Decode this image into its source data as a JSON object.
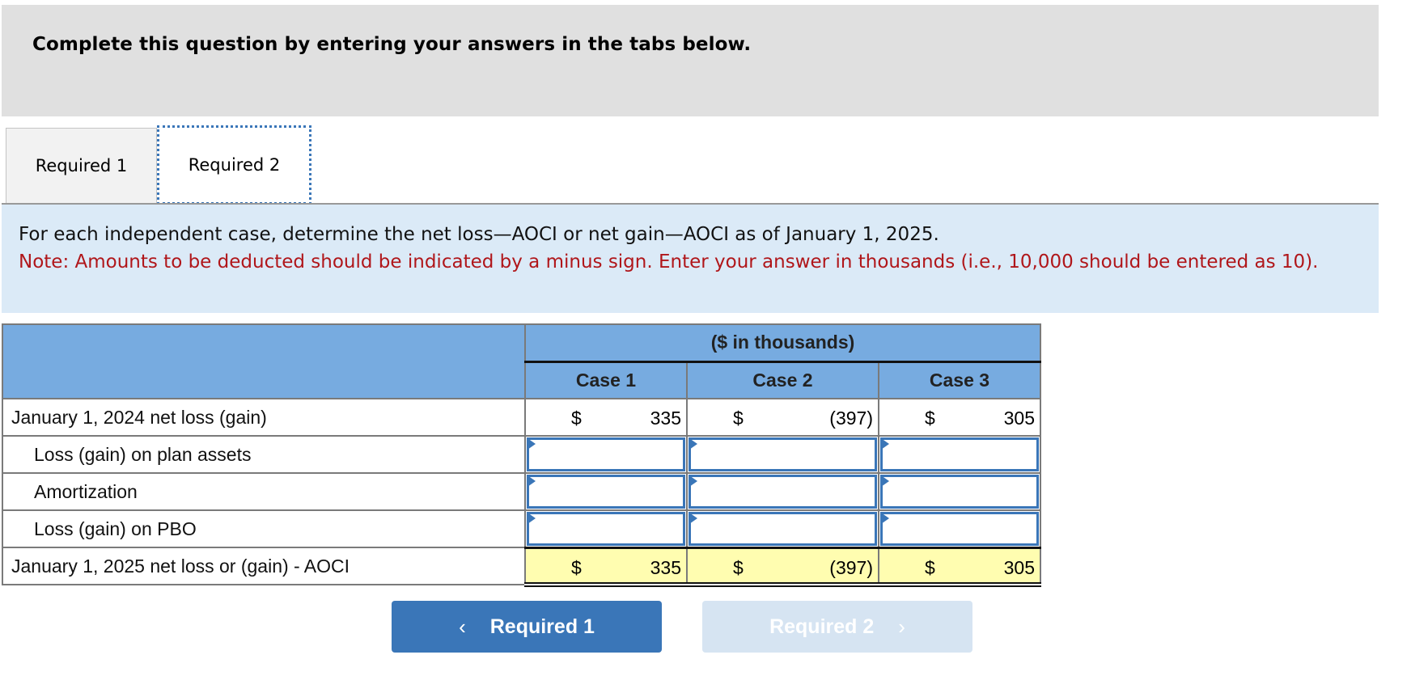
{
  "instructions": "Complete this question by entering your answers in the tabs below.",
  "tabs": [
    {
      "label": "Required 1",
      "active": false
    },
    {
      "label": "Required 2",
      "active": true
    }
  ],
  "prompt": {
    "main": "For each independent case, determine the net loss—AOCI or net gain—AOCI as of January 1, 2025.",
    "note": "Note: Amounts to be deducted should be indicated by a minus sign. Enter your answer in thousands (i.e., 10,000 should be entered as 10)."
  },
  "table": {
    "units_header": "($ in thousands)",
    "case_headers": [
      "Case 1",
      "Case 2",
      "Case 3"
    ],
    "currency_symbol": "$",
    "rows": [
      {
        "label": "January 1, 2024 net loss (gain)",
        "values": [
          "335",
          "(397)",
          "305"
        ],
        "type": "given"
      },
      {
        "label": "Loss (gain) on plan assets",
        "values": [
          "",
          "",
          ""
        ],
        "type": "input"
      },
      {
        "label": "Amortization",
        "values": [
          "",
          "",
          ""
        ],
        "type": "input"
      },
      {
        "label": "Loss (gain) on PBO",
        "values": [
          "",
          "",
          ""
        ],
        "type": "input"
      },
      {
        "label": "January 1, 2025 net loss or (gain) - AOCI",
        "values": [
          "335",
          "(397)",
          "305"
        ],
        "type": "total"
      }
    ]
  },
  "nav": {
    "prev_label": "Required 1",
    "next_label": "Required 2",
    "prev_icon": "chevron-left-icon",
    "next_icon": "chevron-right-icon",
    "next_disabled": true
  },
  "colors": {
    "accent": "#3a76b8",
    "header_bg": "#77abe0",
    "total_bg": "#fffdb0",
    "note_text": "#b0161a",
    "prompt_bg": "#dbeaf7"
  }
}
